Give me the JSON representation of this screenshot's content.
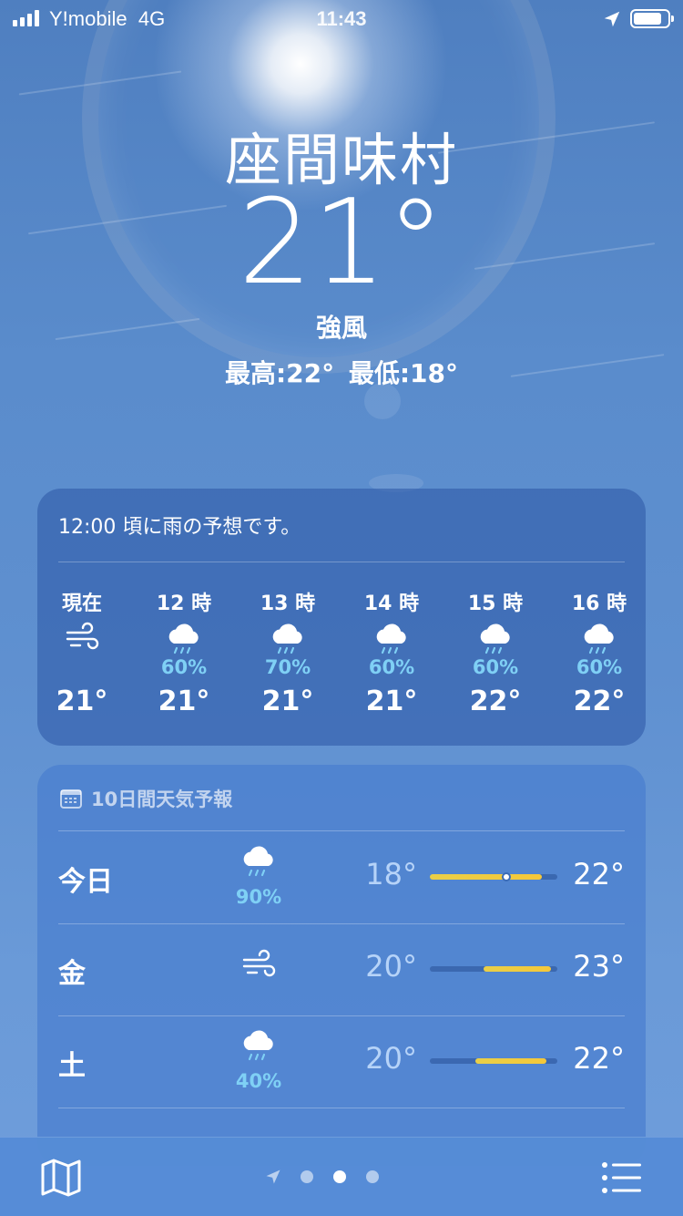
{
  "status": {
    "carrier": "Y!mobile",
    "network": "4G",
    "time": "11:43"
  },
  "location": {
    "city": "座間味村",
    "temperature": "21°",
    "condition": "強風",
    "high_low": "最高:22°  最低:18°"
  },
  "hourly": {
    "summary": "12:00 頃に雨の予想です。",
    "items": [
      {
        "label": "現在",
        "icon": "wind-icon",
        "precip": "",
        "temp": "21°"
      },
      {
        "label": "12 時",
        "icon": "cloud-rain-icon",
        "precip": "60%",
        "temp": "21°"
      },
      {
        "label": "13 時",
        "icon": "cloud-rain-icon",
        "precip": "70%",
        "temp": "21°"
      },
      {
        "label": "14 時",
        "icon": "cloud-rain-icon",
        "precip": "60%",
        "temp": "21°"
      },
      {
        "label": "15 時",
        "icon": "cloud-rain-icon",
        "precip": "60%",
        "temp": "22°"
      },
      {
        "label": "16 時",
        "icon": "cloud-rain-icon",
        "precip": "60%",
        "temp": "22°"
      }
    ]
  },
  "forecast": {
    "title": "10日間天気予報",
    "days": [
      {
        "day": "今日",
        "icon": "cloud-rain-icon",
        "precip": "90%",
        "low": "18°",
        "high": "22°",
        "range_start": 0.0,
        "range_end": 0.88,
        "current_pos": 0.6
      },
      {
        "day": "金",
        "icon": "wind-icon",
        "precip": "",
        "low": "20°",
        "high": "23°",
        "range_start": 0.42,
        "range_end": 0.95
      },
      {
        "day": "土",
        "icon": "cloud-rain-icon",
        "precip": "40%",
        "low": "20°",
        "high": "22°",
        "range_start": 0.36,
        "range_end": 0.92
      }
    ]
  },
  "colors": {
    "precip": "#7fd0f5",
    "temp_bar": "#f5c83a",
    "card_bg": "#305caa"
  },
  "tabbar": {
    "page_count": 4,
    "active_page": 1
  }
}
